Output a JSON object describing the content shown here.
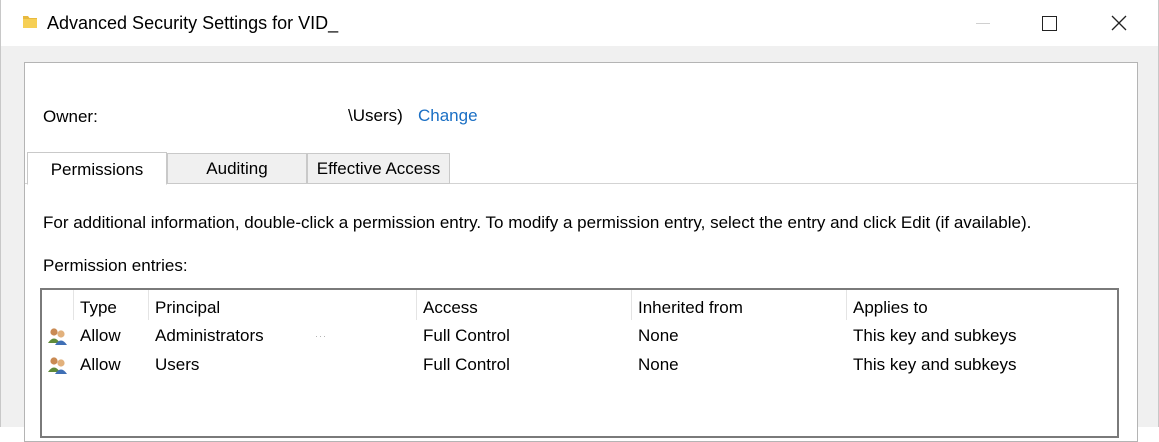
{
  "window": {
    "title": "Advanced Security Settings for VID_",
    "folder_icon": "folder-icon",
    "controls": {
      "minimize": "minimize-icon",
      "maximize": "maximize-icon",
      "close": "close-icon"
    }
  },
  "owner": {
    "label": "Owner:",
    "value": "\\Users)",
    "change_link": "Change"
  },
  "tabs": [
    {
      "label": "Permissions",
      "selected": true
    },
    {
      "label": "Auditing",
      "selected": false
    },
    {
      "label": "Effective Access",
      "selected": false
    }
  ],
  "info_text": "For additional information, double-click a permission entry. To modify a permission entry, select the entry and click Edit (if available).",
  "entries_label": "Permission entries:",
  "table": {
    "columns": [
      "Type",
      "Principal",
      "Access",
      "Inherited from",
      "Applies to"
    ],
    "rows": [
      {
        "icon": "user-group-icon",
        "type": "Allow",
        "principal": "Administrators",
        "access": "Full Control",
        "inherited_from": "None",
        "applies_to": "This key and subkeys"
      },
      {
        "icon": "user-group-icon",
        "type": "Allow",
        "principal": "Users",
        "access": "Full Control",
        "inherited_from": "None",
        "applies_to": "This key and subkeys"
      }
    ]
  },
  "colors": {
    "link": "#1a6fc4",
    "window_bg": "#f0f0f0"
  }
}
